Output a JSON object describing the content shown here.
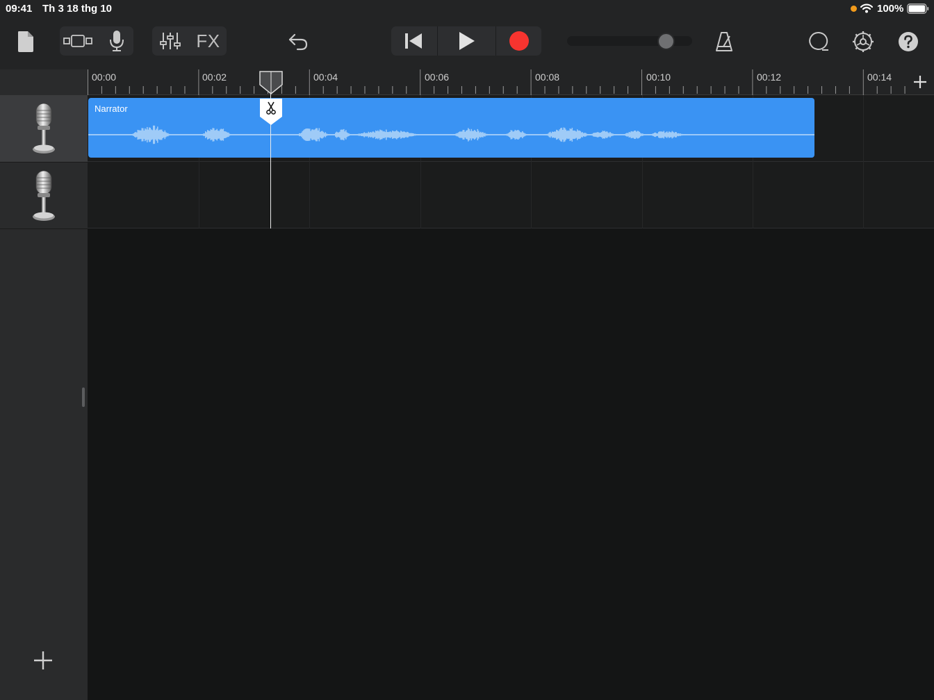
{
  "status_bar": {
    "time": "09:41",
    "date": "Th 3 18 thg 10",
    "battery_percent": "100%",
    "indicator_color": "#f29b1b",
    "icons": [
      "wifi-icon",
      "battery-icon"
    ]
  },
  "toolbar": {
    "fx_label": "FX",
    "record_color": "#f6342f",
    "icons": [
      "document-icon",
      "tracks-view-icon",
      "microphone-icon",
      "mixer-icon",
      "undo-icon",
      "go-to-start-icon",
      "play-icon",
      "record-icon",
      "metronome-icon",
      "loop-icon",
      "settings-icon",
      "help-icon"
    ],
    "volume_level": 0.77
  },
  "ruler": {
    "labels": [
      "00:00",
      "00:02",
      "00:04",
      "00:06",
      "00:08",
      "00:10",
      "00:12",
      "00:14"
    ]
  },
  "tracks": [
    {
      "icon": "microphone-icon",
      "selected": true
    },
    {
      "icon": "microphone-icon",
      "selected": false
    }
  ],
  "region": {
    "name": "Narrator",
    "color": "#3a93f3",
    "waveform_color": "#9fcbf7"
  },
  "playhead": {
    "time_seconds": 3.3,
    "tool": "scissors-icon"
  }
}
